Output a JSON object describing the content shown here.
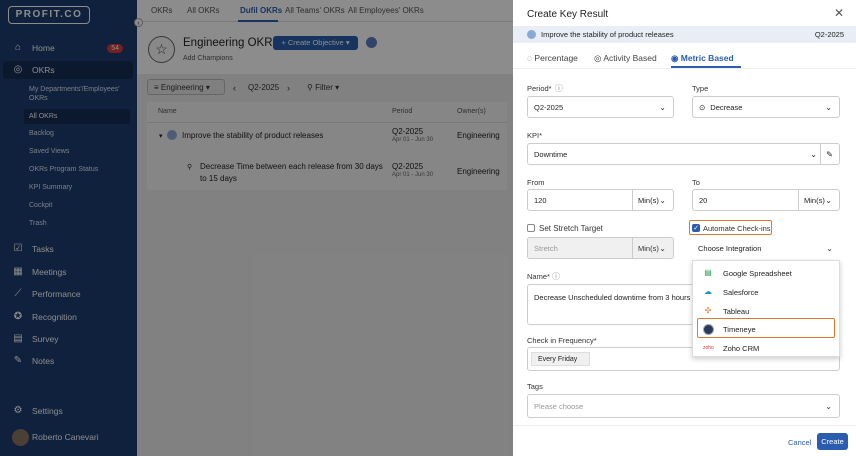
{
  "sidebar": {
    "logo": "PROFIT.CO",
    "items": [
      {
        "label": "Home",
        "badge": "54"
      },
      {
        "label": "OKRs"
      },
      {
        "label": "Tasks"
      },
      {
        "label": "Meetings"
      },
      {
        "label": "Performance"
      },
      {
        "label": "Recognition"
      },
      {
        "label": "Survey"
      },
      {
        "label": "Notes"
      },
      {
        "label": "Settings"
      }
    ],
    "okr_sub": [
      "My Departments'/Employees'",
      "OKRs",
      "All OKRs",
      "Backlog",
      "Saved Views",
      "OKRs Program Status",
      "KPI Summary",
      "Cockpit",
      "Trash"
    ],
    "user": "Roberto Canevari"
  },
  "top_tabs": [
    "OKRs",
    "All OKRs",
    "Dufil OKRs",
    "All Teams' OKRs",
    "All Employees' OKRs"
  ],
  "header": {
    "title": "Engineering OKRs",
    "create_button": "+ Create Objective",
    "add_champions": "Add Champions"
  },
  "toolbar": {
    "team": "Engineering",
    "period": "Q2-2025",
    "filter": "Filter"
  },
  "table": {
    "headers": [
      "Name",
      "Period",
      "Owner(s)"
    ],
    "rows": [
      {
        "name": "Improve the stability of product releases",
        "period": "Q2-2025",
        "dates": "Apr 01 - Jun 30",
        "owner": "Engineering"
      },
      {
        "name": "Decrease Time between each release from 30 days",
        "name2": "to 15 days",
        "period": "Q2-2025",
        "dates": "Apr 01 - Jun 30",
        "owner": "Engineering"
      }
    ]
  },
  "panel": {
    "title": "Create Key Result",
    "objective": "Improve the stability of product releases",
    "objective_period": "Q2-2025",
    "tabs": [
      "Percentage",
      "Activity Based",
      "Metric Based"
    ],
    "period_label": "Period*",
    "period_value": "Q2-2025",
    "type_label": "Type",
    "type_value": "Decrease",
    "kpi_label": "KPI*",
    "kpi_value": "Downtime",
    "from_label": "From",
    "from_value": "120",
    "from_unit": "Min(s)",
    "to_label": "To",
    "to_value": "20",
    "to_unit": "Min(s)",
    "stretch_label": "Set Stretch Target",
    "stretch_placeholder": "Stretch",
    "stretch_unit": "Min(s)",
    "automate_label": "Automate Check-ins",
    "integration_label": "Choose Integration",
    "name_label": "Name*",
    "name_value": "Decrease Unscheduled downtime from 3 hours to 1",
    "checkin_label": "Check in Frequency*",
    "checkin_value": "Every Friday",
    "tags_label": "Tags",
    "tags_placeholder": "Please choose",
    "cancel": "Cancel",
    "create": "Create"
  },
  "integrations": [
    "Google Spreadsheet",
    "Salesforce",
    "Tableau",
    "Timeneye",
    "Zoho CRM"
  ],
  "colors": {
    "sidebar": "#1d3d6e",
    "primary": "#2a5db0",
    "highlight": "#e07a2a"
  }
}
